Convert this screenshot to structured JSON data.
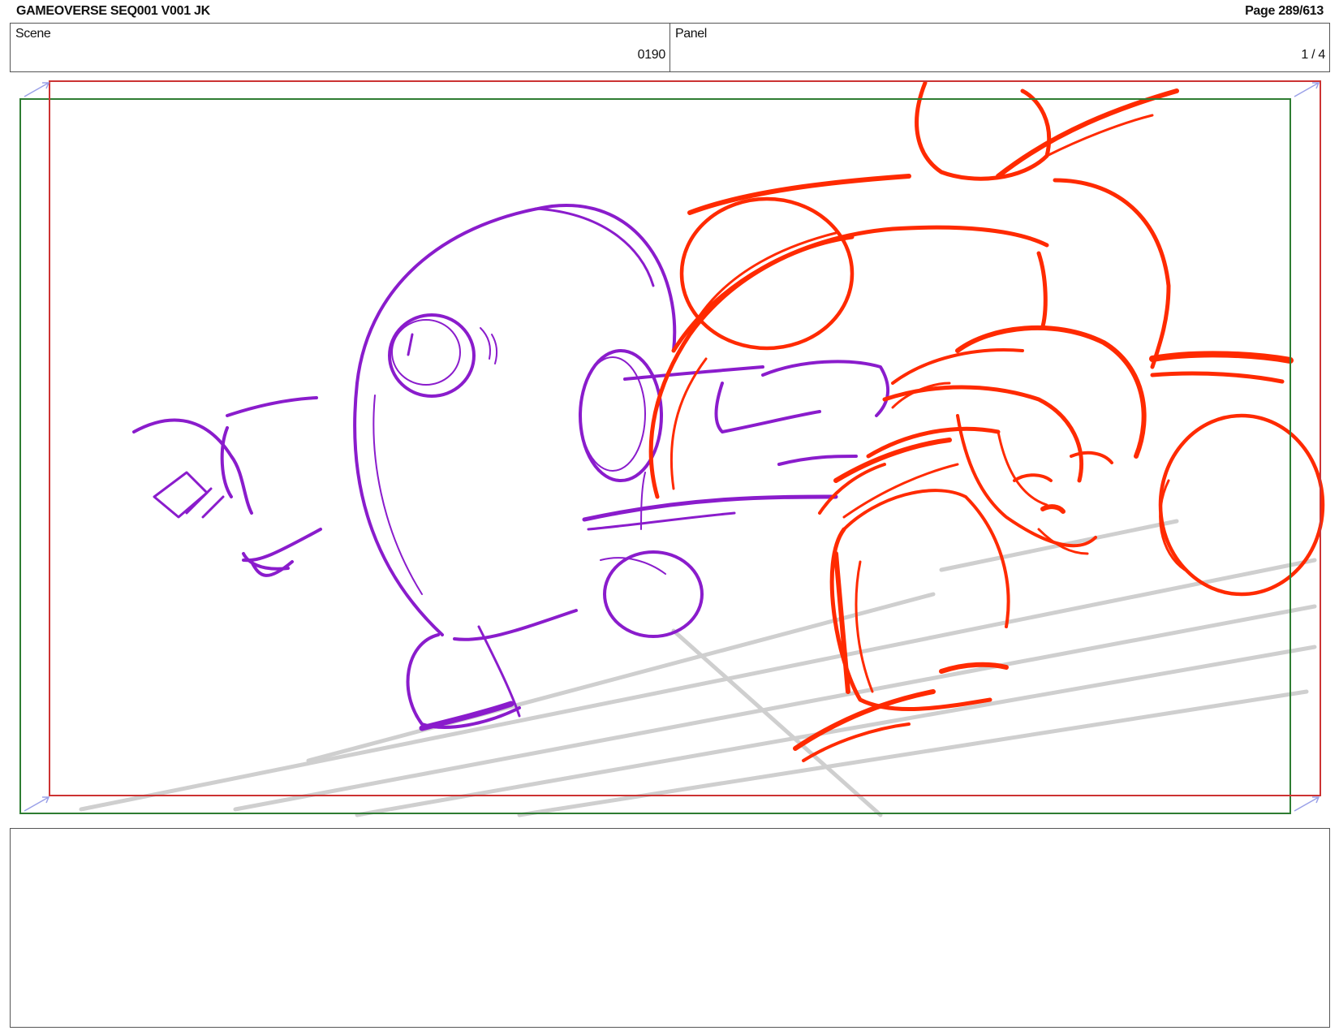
{
  "header": {
    "title": "GAMEOVERSE SEQ001 V001 JK",
    "page": "Page 289/613"
  },
  "info": {
    "scene_label": "Scene",
    "scene_value": "0190",
    "panel_label": "Panel",
    "panel_value": "1 / 4"
  },
  "notes": {
    "text": ""
  },
  "colors": {
    "safe_frame": "#cc3333",
    "camera_frame": "#2e7d32",
    "character_left": "#8a1ccc",
    "character_right": "#ff2a00",
    "floor_lines": "#c8c8c8",
    "corner_marks": "#9aa0e8"
  }
}
